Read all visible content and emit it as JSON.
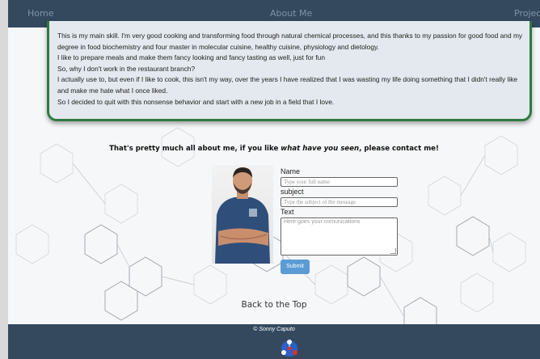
{
  "nav": {
    "home": "Home",
    "about": "About Me",
    "projects": "Projects"
  },
  "about_card": {
    "lines": [
      "This is my main skill. I'm very good cooking and transforming food through natural chemical processes, and this thanks to my passion for good food and my degree in food biochemistry and four master in molecular cuisine, healthy cuisine, physiology and dietology.",
      "I like to prepare meals and make them fancy looking and fancy tasting as well, just for fun",
      "So, why I don't work in the restaurant branch?",
      "I actually use to, but even if I like to cook, this isn't my way, over the years I have realized that I was wasting my life doing something that I didn't really like and make me hate what I once liked.",
      "So I decided to quit with this nonsense behavior and start with a new job in a field that I love."
    ]
  },
  "tagline": {
    "before": "That's pretty much all about me, if you like ",
    "emphasis": "what have you seen",
    "after": ", please contact me!"
  },
  "form": {
    "name_label": "Name",
    "name_placeholder": "Type your full name",
    "subject_label": "subject",
    "subject_placeholder": "Type the subject of the message",
    "text_label": "Text",
    "text_placeholder": "Here goes your comunications",
    "submit_label": "Submit"
  },
  "back_to_top": "Back to the Top",
  "footer": {
    "copyright": "© Sonny Caputo"
  },
  "colors": {
    "nav_bg": "#34495e",
    "card_border": "#2f7a3f",
    "submit_bg": "#5b9bd5"
  }
}
